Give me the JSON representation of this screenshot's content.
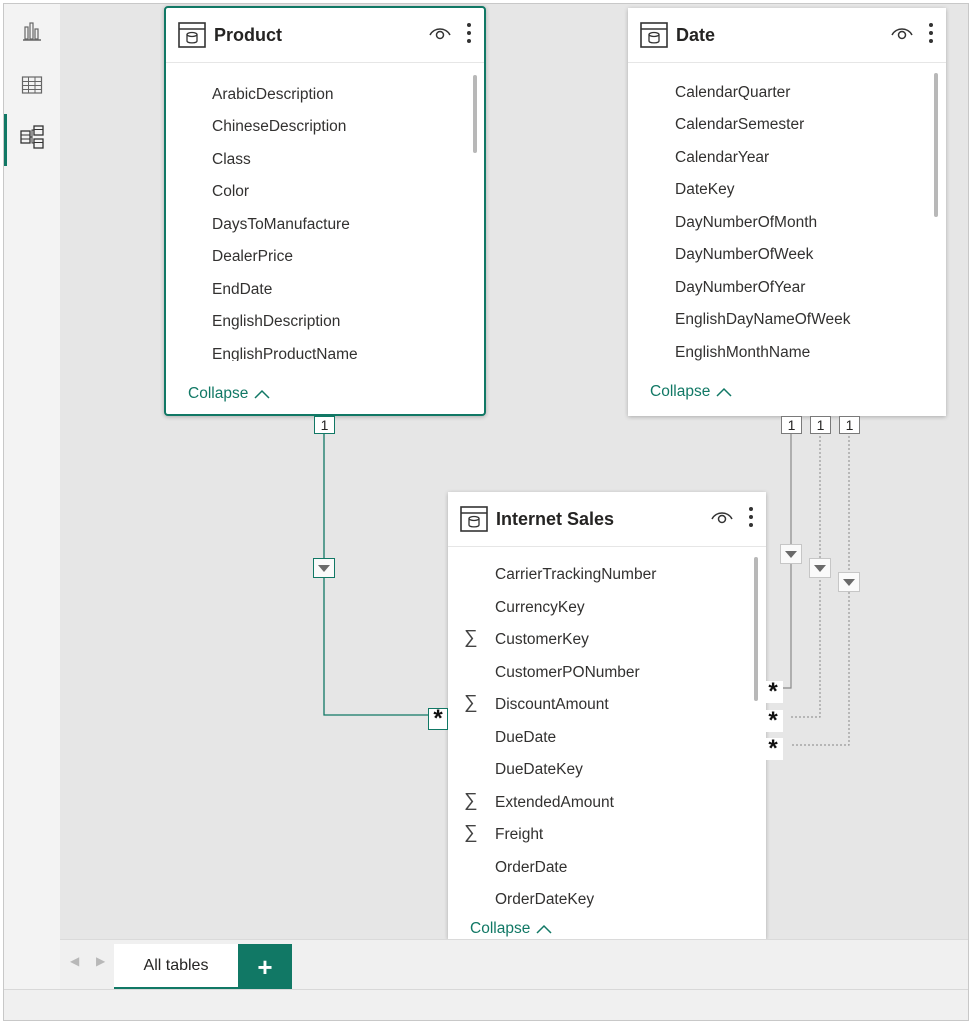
{
  "sidebar": {
    "items": [
      {
        "name": "report-view-icon"
      },
      {
        "name": "table-view-icon"
      },
      {
        "name": "model-view-icon",
        "active": true
      }
    ]
  },
  "tables": {
    "product": {
      "title": "Product",
      "fields": [
        "ArabicDescription",
        "ChineseDescription",
        "Class",
        "Color",
        "DaysToManufacture",
        "DealerPrice",
        "EndDate",
        "EnglishDescription",
        "EnglishProductName"
      ],
      "collapse_label": "Collapse"
    },
    "date": {
      "title": "Date",
      "fields": [
        "CalendarQuarter",
        "CalendarSemester",
        "CalendarYear",
        "DateKey",
        "DayNumberOfMonth",
        "DayNumberOfWeek",
        "DayNumberOfYear",
        "EnglishDayNameOfWeek",
        "EnglishMonthName"
      ],
      "collapse_label": "Collapse"
    },
    "internet_sales": {
      "title": "Internet Sales",
      "fields": [
        {
          "name": "CarrierTrackingNumber",
          "sum": false
        },
        {
          "name": "CurrencyKey",
          "sum": false
        },
        {
          "name": "CustomerKey",
          "sum": true
        },
        {
          "name": "CustomerPONumber",
          "sum": false
        },
        {
          "name": "DiscountAmount",
          "sum": true
        },
        {
          "name": "DueDate",
          "sum": false
        },
        {
          "name": "DueDateKey",
          "sum": false
        },
        {
          "name": "ExtendedAmount",
          "sum": true
        },
        {
          "name": "Freight",
          "sum": true
        },
        {
          "name": "OrderDate",
          "sum": false
        },
        {
          "name": "OrderDateKey",
          "sum": false
        }
      ],
      "collapse_label": "Collapse"
    }
  },
  "relationships": {
    "one_label": "1",
    "many_label": "*",
    "lines": [
      {
        "from": "Product",
        "to": "Internet Sales",
        "active": true
      },
      {
        "from": "Date",
        "to": "Internet Sales",
        "active": true
      },
      {
        "from": "Date",
        "to": "Internet Sales",
        "active": false
      },
      {
        "from": "Date",
        "to": "Internet Sales",
        "active": false
      }
    ]
  },
  "tabs": {
    "items": [
      {
        "label": "All tables",
        "selected": true
      }
    ],
    "add_label": "+",
    "prev_label": "◀",
    "next_label": "▶"
  },
  "colors": {
    "accent": "#117865",
    "line_active": "#8a8a8a",
    "line_inactive": "#9a9a9a"
  }
}
